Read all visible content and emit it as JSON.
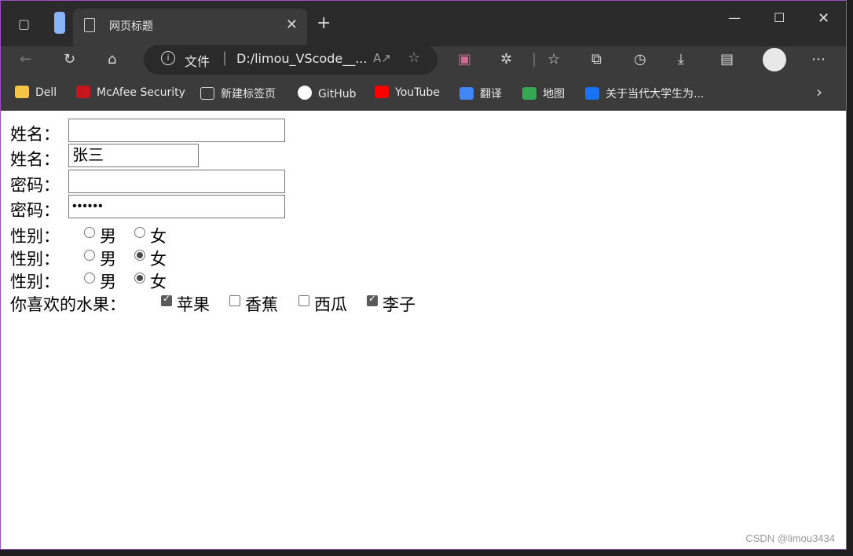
{
  "browser": {
    "tab": {
      "title": "网页标题"
    },
    "address": {
      "scheme_label": "文件",
      "url": "D:/limou_VScode__..."
    },
    "bookmarks": [
      {
        "label": "Dell",
        "icon": "folder-icon",
        "color": "#f3c445"
      },
      {
        "label": "McAfee Security",
        "icon": "mcafee-icon",
        "color": "#c4161c"
      },
      {
        "label": "新建标签页",
        "icon": "new-tab-page-icon",
        "color": "#d8d8d8"
      },
      {
        "label": "GitHub",
        "icon": "github-icon",
        "color": "#ffffff"
      },
      {
        "label": "YouTube",
        "icon": "youtube-icon",
        "color": "#ff0000"
      },
      {
        "label": "翻译",
        "icon": "translate-icon",
        "color": "#4285f4"
      },
      {
        "label": "地图",
        "icon": "maps-icon",
        "color": "#34a853"
      },
      {
        "label": "关于当代大学生为...",
        "icon": "zhihu-icon",
        "color": "#1772f6"
      }
    ]
  },
  "form": {
    "name_label": "姓名：",
    "name_value_2": "张三",
    "password_label": "密码：",
    "password_value_2": "••••••",
    "gender_label": "性别：",
    "male": "男",
    "female": "女",
    "gender_rows": [
      {
        "male_checked": false,
        "female_checked": false
      },
      {
        "male_checked": false,
        "female_checked": true
      },
      {
        "male_checked": false,
        "female_checked": true
      }
    ],
    "fruit_label": "你喜欢的水果：",
    "fruits": [
      {
        "label": "苹果",
        "checked": true
      },
      {
        "label": "香蕉",
        "checked": false
      },
      {
        "label": "西瓜",
        "checked": false
      },
      {
        "label": "李子",
        "checked": true
      }
    ]
  },
  "watermark": "CSDN @limou3434"
}
